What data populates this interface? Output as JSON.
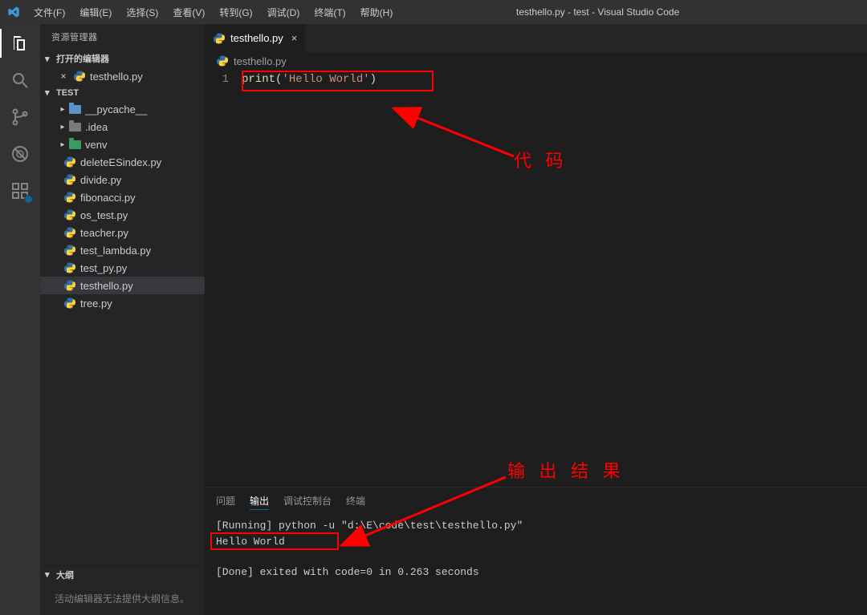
{
  "titlebar": {
    "menus": [
      "文件(F)",
      "编辑(E)",
      "选择(S)",
      "查看(V)",
      "转到(G)",
      "调试(D)",
      "终端(T)",
      "帮助(H)"
    ],
    "title": "testhello.py - test - Visual Studio Code"
  },
  "activitybar": {
    "items": [
      "files-icon",
      "search-icon",
      "git-icon",
      "debug-icon",
      "extensions-icon"
    ]
  },
  "sidebar": {
    "title": "资源管理器",
    "openEditors": {
      "label": "打开的编辑器",
      "items": [
        {
          "name": "testhello.py",
          "dirty": false
        }
      ]
    },
    "folder": {
      "label": "TEST",
      "children": [
        {
          "type": "folder",
          "name": "__pycache__",
          "color": "blue"
        },
        {
          "type": "folder",
          "name": ".idea",
          "color": "gray"
        },
        {
          "type": "folder",
          "name": "venv",
          "color": "green"
        },
        {
          "type": "file",
          "name": "deleteESindex.py"
        },
        {
          "type": "file",
          "name": "divide.py"
        },
        {
          "type": "file",
          "name": "fibonacci.py"
        },
        {
          "type": "file",
          "name": "os_test.py"
        },
        {
          "type": "file",
          "name": "teacher.py"
        },
        {
          "type": "file",
          "name": "test_lambda.py"
        },
        {
          "type": "file",
          "name": "test_py.py"
        },
        {
          "type": "file",
          "name": "testhello.py",
          "selected": true
        },
        {
          "type": "file",
          "name": "tree.py"
        }
      ]
    },
    "outline": {
      "label": "大纲",
      "message": "活动编辑器无法提供大纲信息。"
    }
  },
  "editor": {
    "tab": {
      "name": "testhello.py"
    },
    "breadcrumb": "testhello.py",
    "code": {
      "lineNumber": "1",
      "fn": "print",
      "open": "(",
      "str": "'Hello World'",
      "close": ")"
    }
  },
  "panel": {
    "tabs": [
      "问题",
      "输出",
      "调试控制台",
      "终端"
    ],
    "activeTab": 1,
    "output": {
      "line1": "[Running] python -u \"d:\\E\\code\\test\\testhello.py\"",
      "line2": "Hello World",
      "line3": "[Done] exited with code=0 in 0.263 seconds"
    }
  },
  "annotations": {
    "codeLabel": "代 码",
    "outputLabel": "输 出 结 果"
  },
  "colors": {
    "red": "#ff0000",
    "accent": "#0e639c"
  }
}
